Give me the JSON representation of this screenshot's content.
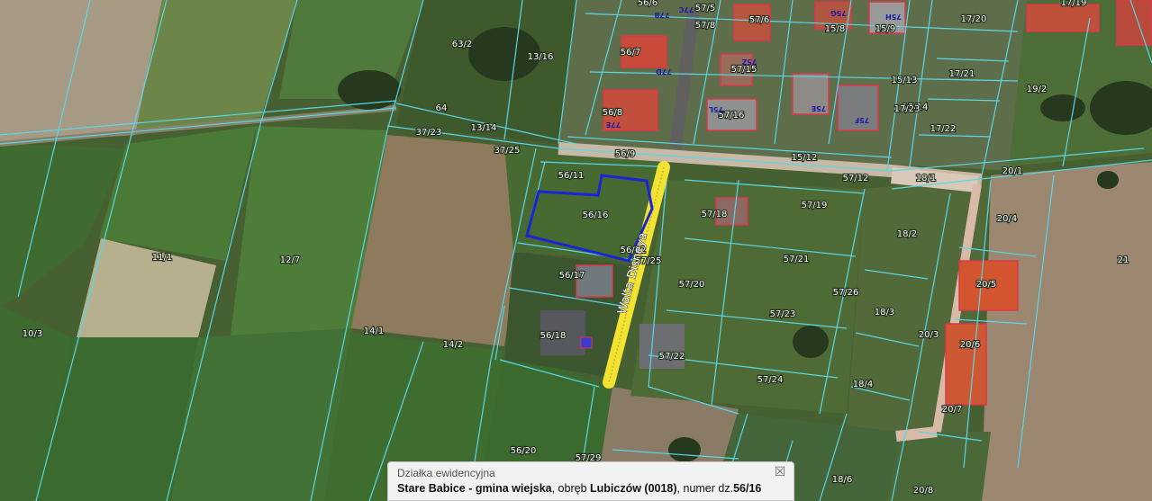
{
  "parcel_labels": [
    "63/2",
    "13/16",
    "64",
    "13/14",
    "37/23",
    "37/25",
    "56/8",
    "56/9",
    "56/7",
    "56/6",
    "57/8",
    "57/5",
    "57/6",
    "57/15",
    "57/16",
    "15/8",
    "15/9",
    "15/12",
    "15/13",
    "15/14",
    "17/20",
    "17/19",
    "17/21",
    "17/22",
    "17/23",
    "19/2",
    "56/11",
    "56/16",
    "56/12",
    "57/25",
    "56/17",
    "56/18",
    "57/18",
    "57/19",
    "57/12",
    "18/1",
    "20/1",
    "20/4",
    "18/2",
    "57/20",
    "57/21",
    "57/26",
    "57/23",
    "57/24",
    "57/22",
    "18/3",
    "18/4",
    "20/3",
    "20/5",
    "20/6",
    "20/7",
    "21",
    "11/1",
    "12/7",
    "10/3",
    "14/1",
    "14/2",
    "56/20",
    "57/29",
    "18/6",
    "20/8"
  ],
  "street_label": "Walta Disneya",
  "building_labels": [
    "77D",
    "77C",
    "75Z",
    "77B",
    "77E",
    "75L",
    "75E",
    "75F",
    "75G",
    "75H"
  ],
  "popup": {
    "title": "Działka ewidencyjna",
    "municipality": "Stare Babice - gmina wiejska",
    "sep1": ", obręb ",
    "precinct": "Lubiczów (0018)",
    "sep2": ", numer dz.",
    "parcel_number": "56/16",
    "close_glyph": "☒"
  },
  "colors": {
    "parcel_boundary": "#5ad6e6",
    "highlight_parcel": "#1a24d6",
    "street_highlight": "#f2e232",
    "building_outline": "#e0354a",
    "building_label": "#1a1aa8"
  },
  "icons": [
    "close-icon"
  ]
}
